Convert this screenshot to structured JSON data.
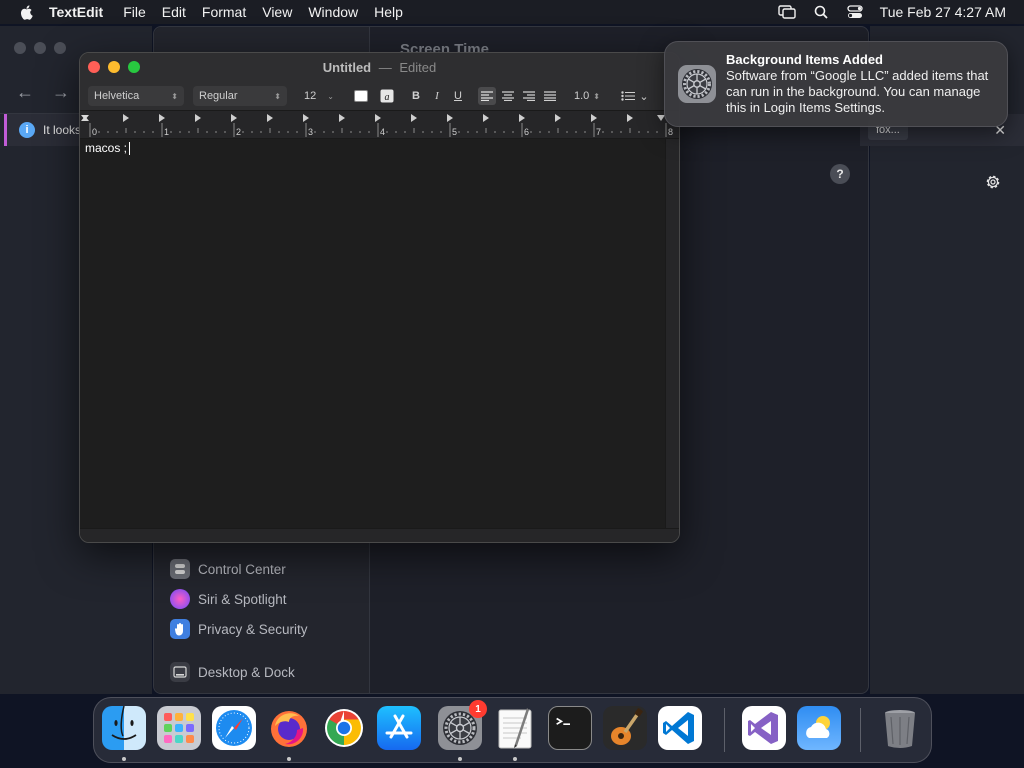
{
  "menubar": {
    "app_name": "TextEdit",
    "menus": [
      "File",
      "Edit",
      "Format",
      "View",
      "Window",
      "Help"
    ],
    "clock": "Tue Feb 27  4:27 AM",
    "icons": [
      "screen-mirroring-icon",
      "spotlight-search-icon",
      "control-center-icon"
    ]
  },
  "background": {
    "banner_text": "It looks",
    "banner_button": "fox...",
    "settings_title": "Screen Time",
    "sidebar_items": [
      {
        "label": "Control Center",
        "icon": "control-center-icon",
        "color": "#6b6e76"
      },
      {
        "label": "Siri & Spotlight",
        "icon": "siri-icon",
        "color": "#b84ad8"
      },
      {
        "label": "Privacy & Security",
        "icon": "hand-icon",
        "color": "#3f7fe0"
      },
      {
        "label": "Desktop & Dock",
        "icon": "desktop-dock-icon",
        "color": "#3a3c44"
      }
    ],
    "help_label": "?"
  },
  "textedit": {
    "title": "Untitled",
    "title_separator": "—",
    "status": "Edited",
    "font_family": "Helvetica",
    "font_style": "Regular",
    "font_size": "12",
    "bold_label": "B",
    "italic_label": "I",
    "underline_label": "U",
    "line_spacing": "1.0",
    "ruler_numbers": [
      "0",
      "1",
      "2",
      "3",
      "4",
      "5",
      "6",
      "7",
      "8"
    ],
    "document_text": "macos ;"
  },
  "notification": {
    "title": "Background Items Added",
    "body": "Software from “Google LLC” added items that can run in the background. You can manage this in Login Items Settings.",
    "icon": "system-settings-gear-icon"
  },
  "dock": {
    "apps": [
      {
        "name": "Finder",
        "icon": "finder-icon",
        "running": true
      },
      {
        "name": "Launchpad",
        "icon": "launchpad-icon",
        "running": false
      },
      {
        "name": "Safari",
        "icon": "safari-icon",
        "running": false
      },
      {
        "name": "Firefox",
        "icon": "firefox-icon",
        "running": true
      },
      {
        "name": "Chrome",
        "icon": "chrome-icon",
        "running": false
      },
      {
        "name": "App Store",
        "icon": "app-store-icon",
        "running": false
      },
      {
        "name": "System Settings",
        "icon": "system-settings-icon",
        "running": true,
        "badge": "1"
      },
      {
        "name": "TextEdit",
        "icon": "textedit-icon",
        "running": true
      },
      {
        "name": "Terminal",
        "icon": "terminal-icon",
        "running": false
      },
      {
        "name": "GarageBand",
        "icon": "garageband-icon",
        "running": false
      },
      {
        "name": "Visual Studio Code",
        "icon": "vscode-icon",
        "running": false
      },
      {
        "name": "Visual Studio",
        "icon": "visual-studio-icon",
        "running": false
      },
      {
        "name": "Weather",
        "icon": "weather-icon",
        "running": false
      },
      {
        "name": "Trash",
        "icon": "trash-icon",
        "running": false
      }
    ]
  },
  "colors": {
    "accent_close": "#ff5f57",
    "accent_minimize": "#febc2e",
    "accent_maximize": "#28c840",
    "badge": "#ff3b30"
  }
}
